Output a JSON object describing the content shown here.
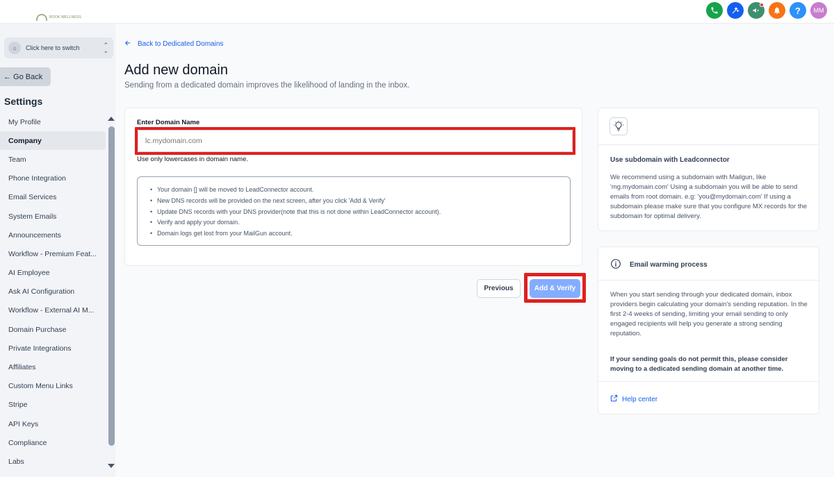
{
  "topbar": {
    "logo_text": "ROOK WELLNESS",
    "icons": [
      {
        "name": "phone-icon",
        "color": "#16a34a"
      },
      {
        "name": "magic-wand-icon",
        "color": "#155eef"
      },
      {
        "name": "megaphone-icon",
        "color": "#3f8f6f"
      },
      {
        "name": "bell-icon",
        "color": "#f97316"
      },
      {
        "name": "help-icon",
        "color": "#2e90fa"
      }
    ],
    "avatar_initials": "MM",
    "avatar_color": "#c77dce"
  },
  "sidebar": {
    "switcher_label": "Click here to switch",
    "go_back_label": "← Go Back",
    "section_title": "Settings",
    "items": [
      {
        "label": "My Profile"
      },
      {
        "label": "Company"
      },
      {
        "label": "Team"
      },
      {
        "label": "Phone Integration"
      },
      {
        "label": "Email Services"
      },
      {
        "label": "System Emails"
      },
      {
        "label": "Announcements"
      },
      {
        "label": "Workflow - Premium Feat..."
      },
      {
        "label": "AI Employee"
      },
      {
        "label": "Ask AI Configuration"
      },
      {
        "label": "Workflow - External AI M..."
      },
      {
        "label": "Domain Purchase"
      },
      {
        "label": "Private Integrations"
      },
      {
        "label": "Affiliates"
      },
      {
        "label": "Custom Menu Links"
      },
      {
        "label": "Stripe"
      },
      {
        "label": "API Keys"
      },
      {
        "label": "Compliance"
      },
      {
        "label": "Labs"
      }
    ],
    "active_item": "Company"
  },
  "main": {
    "back_link": "Back to Dedicated Domains",
    "title": "Add new domain",
    "subtitle": "Sending from a dedicated domain improves the likelihood of landing in the inbox.",
    "form": {
      "domain_label": "Enter Domain Name",
      "domain_placeholder": "lc.mydomain.com",
      "domain_value": "",
      "hint": "Use only lowercases in domain name.",
      "notes": [
        "Your domain [] will be moved to LeadConnector account.",
        "New DNS records will be provided on the next screen, after you click 'Add & Verify'",
        "Update DNS records with your DNS provider(note that this is not done within LeadConnector account).",
        "Verify and apply your domain.",
        "Domain logs get lost from your MailGun account."
      ]
    },
    "buttons": {
      "previous": "Previous",
      "add_verify": "Add & Verify"
    }
  },
  "right": {
    "tip": {
      "title": "Use subdomain with Leadconnector",
      "body": "We recommend using a subdomain with Mailgun, like 'mg.mydomain.com' Using a subdomain you will be able to send emails from root domain. e.g: 'you@mydomain.com' If using a subdomain please make sure that you configure MX records for the subdomain for optimal delivery."
    },
    "warming": {
      "title": "Email warming process",
      "body": "When you start sending through your dedicated domain, inbox providers begin calculating your domain's sending reputation. In the first 2-4 weeks of sending, limiting your email sending to only engaged recipients will help you generate a strong sending reputation.",
      "strong": "If your sending goals do not permit this, please consider moving to a dedicated sending domain at another time.",
      "help_link": "Help center"
    }
  },
  "colors": {
    "accent": "#155eef",
    "highlight": "#e02020",
    "primary_button": "#84adff"
  }
}
